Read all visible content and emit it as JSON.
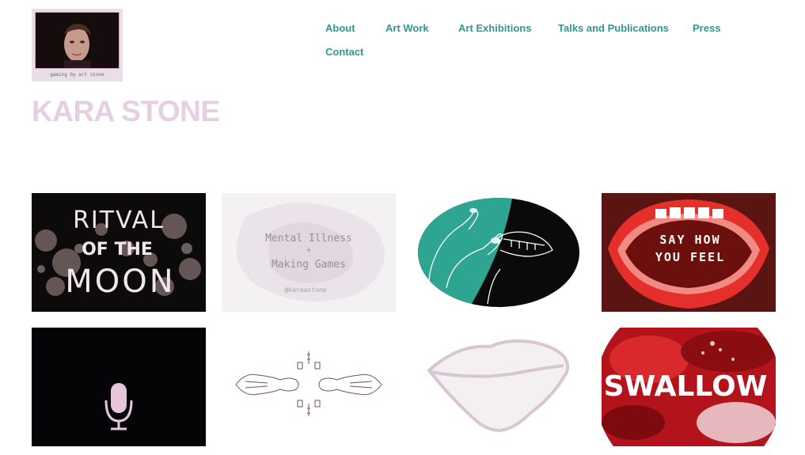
{
  "profile": {
    "caption": "gaming by art stone",
    "accent": "#e6cfe0"
  },
  "nav": {
    "items": [
      {
        "label": "About"
      },
      {
        "label": "Art Work"
      },
      {
        "label": "Art Exhibitions"
      },
      {
        "label": "Talks and Publications"
      },
      {
        "label": "Press"
      },
      {
        "label": "Contact"
      }
    ],
    "color": "#2f9a8a"
  },
  "site": {
    "title": "KARA STONE"
  },
  "gallery": {
    "tiles": [
      {
        "text_line1": "RITVAL",
        "text_line2": "OF THE",
        "text_line3": "MOON",
        "icon": "ritual-moon-art"
      },
      {
        "text_line1": "Mental Illness",
        "text_line2": "+",
        "text_line3": "Making Games",
        "text_line4": "@karaastone",
        "icon": "mental-illness-card"
      },
      {
        "icon": "hand-mouth-art"
      },
      {
        "text_line1": "SAY HOW",
        "text_line2": "YOU FEEL",
        "icon": "say-how-you-feel-mouth"
      },
      {
        "icon": "microphone-icon"
      },
      {
        "icon": "figures-drawing"
      },
      {
        "icon": "lips-outline"
      },
      {
        "text_line1": "SWALLOW",
        "icon": "swallow-art"
      }
    ]
  }
}
